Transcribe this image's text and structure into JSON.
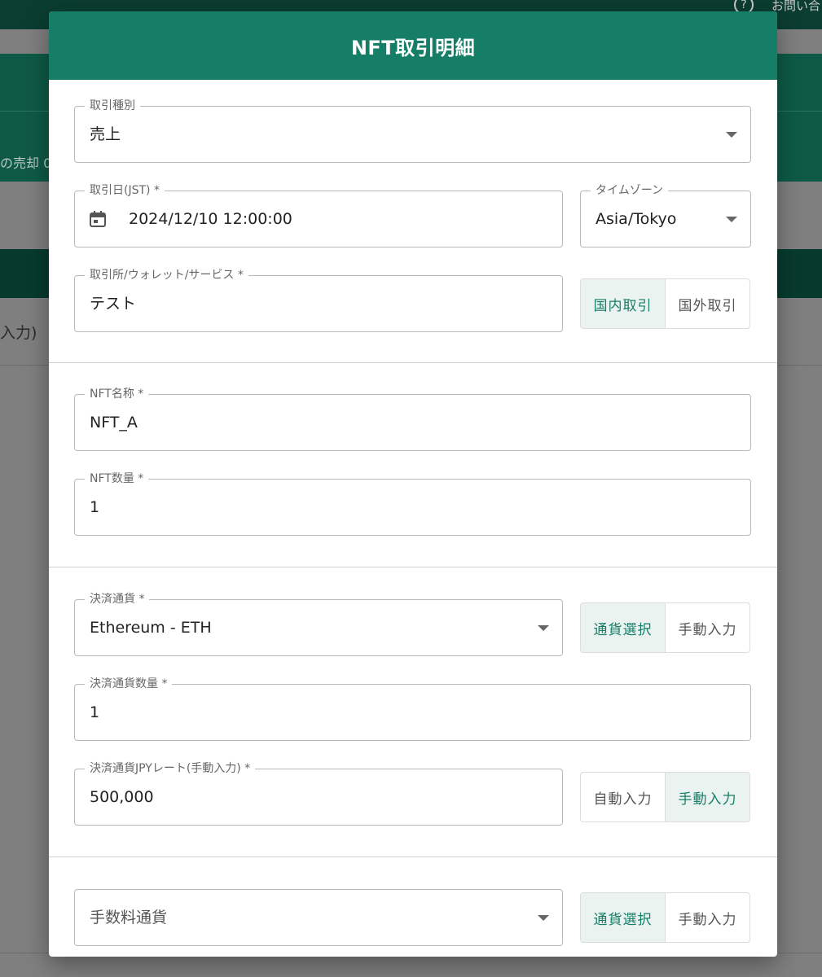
{
  "background": {
    "help_icon": "?",
    "help_text": "お問い合",
    "panel_text": "の売却 0",
    "row_text": "入力)"
  },
  "dialog": {
    "title": "NFT取引明細"
  },
  "section1": {
    "trade_type": {
      "label": "取引種別",
      "value": "売上"
    },
    "trade_date": {
      "label": "取引日(JST) *",
      "value": "2024/12/10 12:00:00",
      "icon": "calendar-icon"
    },
    "timezone": {
      "label": "タイムゾーン",
      "value": "Asia/Tokyo"
    },
    "exchange": {
      "label": "取引所/ウォレット/サービス *",
      "value": "テスト"
    },
    "exchange_toggle": {
      "options": [
        "国内取引",
        "国外取引"
      ],
      "selected": "国内取引"
    }
  },
  "section2": {
    "nft_name": {
      "label": "NFT名称 *",
      "value": "NFT_A"
    },
    "nft_qty": {
      "label": "NFT数量 *",
      "value": "1"
    }
  },
  "section3": {
    "currency": {
      "label": "決済通貨 *",
      "value": "Ethereum - ETH"
    },
    "currency_toggle": {
      "options": [
        "通貨選択",
        "手動入力"
      ],
      "selected": "通貨選択"
    },
    "currency_qty": {
      "label": "決済通貨数量 *",
      "value": "1"
    },
    "jpy_rate": {
      "label": "決済通貨JPYレート(手動入力) *",
      "value": "500,000"
    },
    "rate_toggle": {
      "options": [
        "自動入力",
        "手動入力"
      ],
      "selected": "手動入力"
    }
  },
  "section4": {
    "fee_currency": {
      "placeholder": "手数料通貨"
    },
    "fee_toggle": {
      "options": [
        "通貨選択",
        "手動入力"
      ],
      "selected": "通貨選択"
    }
  },
  "colors": {
    "header": "#167e67",
    "accent_text": "#167e67",
    "selected_toggle_bg": "#eaf3f0",
    "backdrop": "#7f7f7f"
  }
}
